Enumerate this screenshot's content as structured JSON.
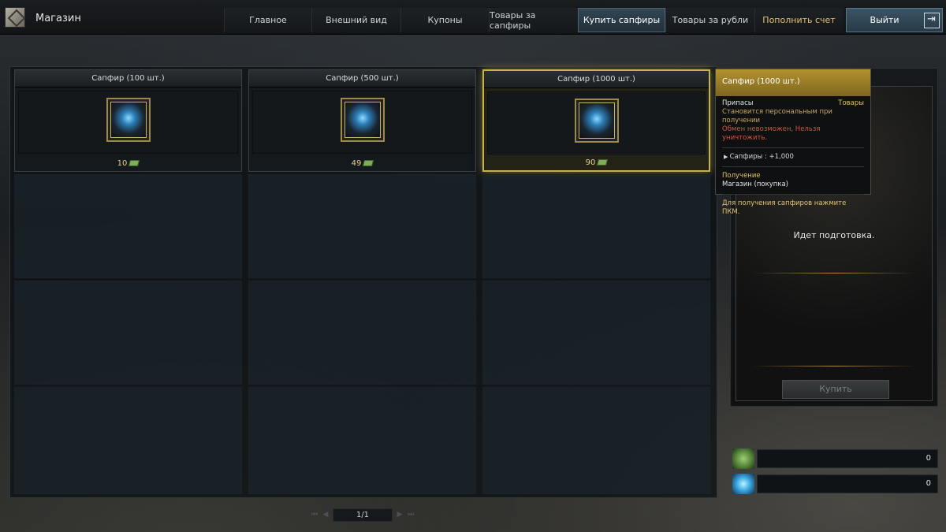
{
  "app": {
    "title": "Магазин"
  },
  "nav": {
    "tabs": [
      {
        "label": "Главное"
      },
      {
        "label": "Внешний вид"
      },
      {
        "label": "Купоны"
      },
      {
        "label": "Товары за сапфиры"
      },
      {
        "label": "Купить сапфиры",
        "active": true
      },
      {
        "label": "Товары за рубли"
      },
      {
        "label": "Пополнить счет",
        "highlight": true
      }
    ],
    "exit_label": "Выйти"
  },
  "grid": {
    "items": [
      {
        "name": "Сапфир (100 шт.)",
        "price": "10",
        "icon": "sapphire-pouch-icon"
      },
      {
        "name": "Сапфир (500 шт.)",
        "price": "49",
        "icon": "sapphire-goblet-icon"
      },
      {
        "name": "Сапфир (1000 шт.)",
        "price": "90",
        "icon": "sapphire-cup-icon",
        "selected": true
      }
    ],
    "empty_slots": 9
  },
  "pager": {
    "label": "1/1"
  },
  "tooltip": {
    "title": "Сапфир (1000 шт.)",
    "category": "Припасы",
    "type": "Товары",
    "personal": "Становится персональным при получении",
    "warning": "Обмен невозможен, Нельзя уничтожить.",
    "effect": "Сапфиры : +1,000",
    "obtain_header": "Получение",
    "obtain": "Магазин (покупка)",
    "hint": "Для получения сапфиров нажмите ПКМ."
  },
  "preview": {
    "status": "Идет подготовка.",
    "buy_label": "Купить"
  },
  "currency": [
    {
      "icon": "cash-icon",
      "value": "0"
    },
    {
      "icon": "sapphire-icon",
      "value": "0"
    }
  ],
  "colors": {
    "accent_gold": "#c6b24d",
    "active_tab": "#324654",
    "warning": "#d2553f"
  }
}
